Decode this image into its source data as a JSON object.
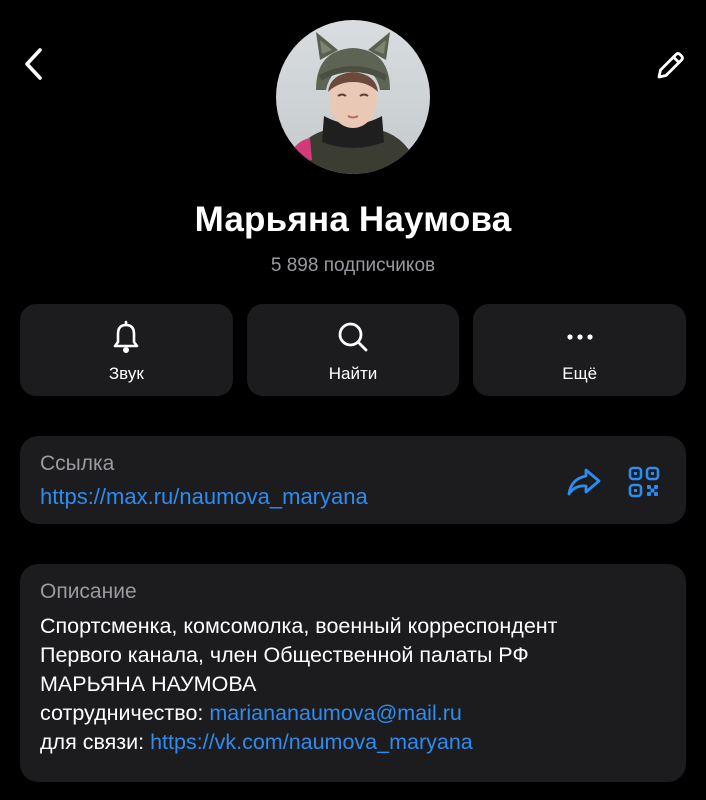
{
  "profile": {
    "name": "Марьяна Наумова",
    "subscribers": "5 898 подписчиков"
  },
  "actions": [
    {
      "label": "Звук",
      "icon": "bell-icon"
    },
    {
      "label": "Найти",
      "icon": "search-icon"
    },
    {
      "label": "Ещё",
      "icon": "more-dots-icon"
    }
  ],
  "link": {
    "title": "Ссылка",
    "url": "https://max.ru/naumova_maryana"
  },
  "description": {
    "title": "Описание",
    "line1": "Спортсменка, комсомолка, военный корреспондент",
    "line2": "Первого канала, член Общественной палаты РФ",
    "line3": "МАРЬЯНА НАУМОВА",
    "coop_label": "сотрудничество: ",
    "coop_email": "mariananaumova@mail.ru",
    "contact_label": "для связи: ",
    "contact_url": "https://vk.com/naumova_maryana"
  },
  "colors": {
    "background": "#000000",
    "card": "#1c1c1f",
    "accent": "#2d8cf0",
    "muted": "#9a9aa0"
  }
}
